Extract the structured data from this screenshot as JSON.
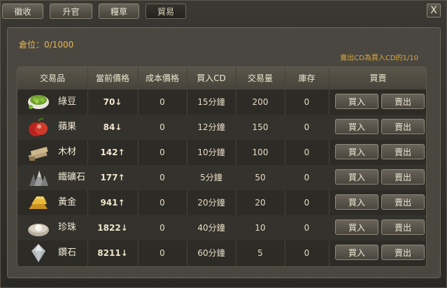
{
  "tabs": [
    {
      "label": "徽收",
      "active": false
    },
    {
      "label": "升官",
      "active": false
    },
    {
      "label": "糧草",
      "active": false
    },
    {
      "label": "貿易",
      "active": true
    }
  ],
  "close_label": "X",
  "storage": "倉位：0/1000",
  "cd_note": "賣出CD為買入CD的1/10",
  "headers": [
    "交易品",
    "當前價格",
    "成本價格",
    "買入CD",
    "交易量",
    "庫存",
    "買賣"
  ],
  "buttons": {
    "buy": "買入",
    "sell": "賣出"
  },
  "items": [
    {
      "name": "綠豆",
      "icon": "mung-bean-icon",
      "price": "70↓",
      "cost": "0",
      "cd": "15分鐘",
      "volume": "200",
      "stock": "0"
    },
    {
      "name": "蘋果",
      "icon": "apple-icon",
      "price": "84↓",
      "cost": "0",
      "cd": "12分鐘",
      "volume": "150",
      "stock": "0"
    },
    {
      "name": "木材",
      "icon": "wood-icon",
      "price": "142↑",
      "cost": "0",
      "cd": "10分鐘",
      "volume": "100",
      "stock": "0"
    },
    {
      "name": "鐵礦石",
      "icon": "iron-ore-icon",
      "price": "177↑",
      "cost": "0",
      "cd": "5分鐘",
      "volume": "50",
      "stock": "0"
    },
    {
      "name": "黃金",
      "icon": "gold-icon",
      "price": "941↑",
      "cost": "0",
      "cd": "20分鐘",
      "volume": "20",
      "stock": "0"
    },
    {
      "name": "珍珠",
      "icon": "pearl-icon",
      "price": "1822↓",
      "cost": "0",
      "cd": "40分鐘",
      "volume": "10",
      "stock": "0"
    },
    {
      "name": "鑽石",
      "icon": "diamond-icon",
      "price": "8211↓",
      "cost": "0",
      "cd": "60分鐘",
      "volume": "5",
      "stock": "0"
    }
  ]
}
